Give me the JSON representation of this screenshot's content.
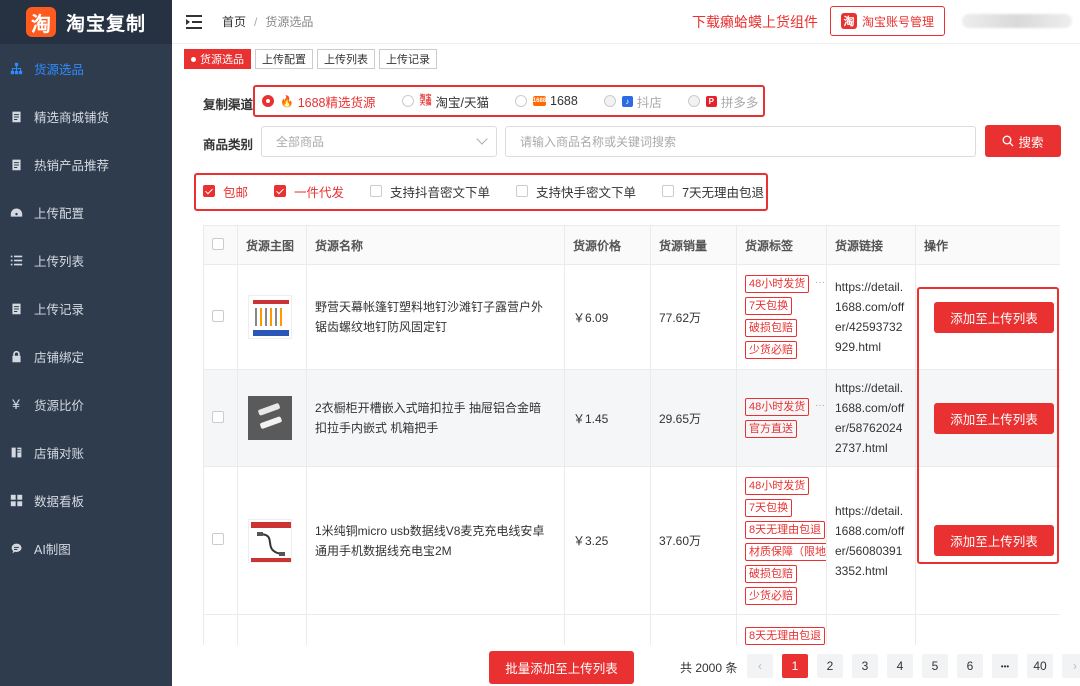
{
  "app": {
    "logo_char": "淘",
    "title": "淘宝复制"
  },
  "colors": {
    "accent": "#e93131",
    "sidebar_bg": "#2f3c4e",
    "sidebar_active": "#2f8cff"
  },
  "sidebar": {
    "items": [
      {
        "label": "货源选品",
        "icon": "sitemap-icon",
        "active": true
      },
      {
        "label": "精选商城铺货",
        "icon": "clipboard-icon"
      },
      {
        "label": "热销产品推荐",
        "icon": "clipboard-icon"
      },
      {
        "label": "上传配置",
        "icon": "dashboard-icon"
      },
      {
        "label": "上传列表",
        "icon": "list-icon"
      },
      {
        "label": "上传记录",
        "icon": "clipboard-icon"
      },
      {
        "label": "店铺绑定",
        "icon": "lock-icon"
      },
      {
        "label": "货源比价",
        "icon": "yen-icon"
      },
      {
        "label": "店铺对账",
        "icon": "book-icon"
      },
      {
        "label": "数据看板",
        "icon": "grid-icon"
      },
      {
        "label": "AI制图",
        "icon": "ai-icon"
      }
    ]
  },
  "header": {
    "breadcrumb_home": "首页",
    "breadcrumb_sep": "/",
    "breadcrumb_current": "货源选品",
    "download_link": "下载癞蛤蟆上货组件",
    "account_button": "淘宝账号管理",
    "account_icon_char": "淘"
  },
  "tabs": [
    {
      "label": "货源选品",
      "active": true
    },
    {
      "label": "上传配置"
    },
    {
      "label": "上传列表"
    },
    {
      "label": "上传记录"
    }
  ],
  "filters": {
    "channel_label": "复制渠道",
    "channels": [
      {
        "label": "1688精选货源",
        "icon": "fire-icon",
        "selected": true
      },
      {
        "label": "淘宝/天猫",
        "icon": "taobao-tmall-icon",
        "icon_text": "淘宝天猫"
      },
      {
        "label": "1688",
        "icon": "1688-icon",
        "icon_text": "1688"
      },
      {
        "label": "抖店",
        "icon": "douyin-icon",
        "disabled": true
      },
      {
        "label": "拼多多",
        "icon": "pinduoduo-icon",
        "disabled": true
      }
    ],
    "category_label": "商品类别",
    "category_value": "全部商品",
    "search_placeholder": "请输入商品名称或关键词搜索",
    "search_button": "搜索",
    "options": [
      {
        "label": "包邮",
        "checked": true
      },
      {
        "label": "一件代发",
        "checked": true
      },
      {
        "label": "支持抖音密文下单",
        "checked": false
      },
      {
        "label": "支持快手密文下单",
        "checked": false
      },
      {
        "label": "7天无理由包退",
        "checked": false
      }
    ]
  },
  "table": {
    "headers": [
      "货源主图",
      "货源名称",
      "货源价格",
      "货源销量",
      "货源标签",
      "货源链接",
      "操作"
    ],
    "rows": [
      {
        "name": "野营天幕帐篷钉塑料地钉沙滩钉子露营户外锯齿螺纹地钉防风固定钉",
        "price": "￥6.09",
        "sales": "77.62万",
        "tags": [
          "48小时发货",
          "7天包换",
          "破损包赔",
          "少货必赔"
        ],
        "link": "https://detail.1688.com/offer/42593732929.html",
        "action": "添加至上传列表"
      },
      {
        "name": "2衣橱柜开槽嵌入式暗扣拉手 抽屉铝合金暗扣拉手内嵌式 机箱把手",
        "price": "￥1.45",
        "sales": "29.65万",
        "tags": [
          "48小时发货",
          "官方直送"
        ],
        "link": "https://detail.1688.com/offer/587620242737.html",
        "action": "添加至上传列表"
      },
      {
        "name": "1米纯铜micro usb数据线V8麦克充电线安卓通用手机数据线充电宝2M",
        "price": "￥3.25",
        "sales": "37.60万",
        "tags": [
          "48小时发货",
          "7天包换",
          "8天无理由包退",
          "材质保障（限地",
          "破损包赔",
          "少货必赔"
        ],
        "link": "https://detail.1688.com/offer/560803913352.html",
        "action": "添加至上传列表"
      },
      {
        "name": "",
        "price": "",
        "sales": "",
        "tags": [
          "8天无理由包退"
        ],
        "link": "",
        "action": ""
      }
    ]
  },
  "footer": {
    "batch_button": "批量添加至上传列表",
    "total": "共 2000 条",
    "pages": [
      "1",
      "2",
      "3",
      "4",
      "5",
      "6",
      "•••",
      "40"
    ],
    "current_page": "1",
    "prev": "‹",
    "next": "›"
  }
}
